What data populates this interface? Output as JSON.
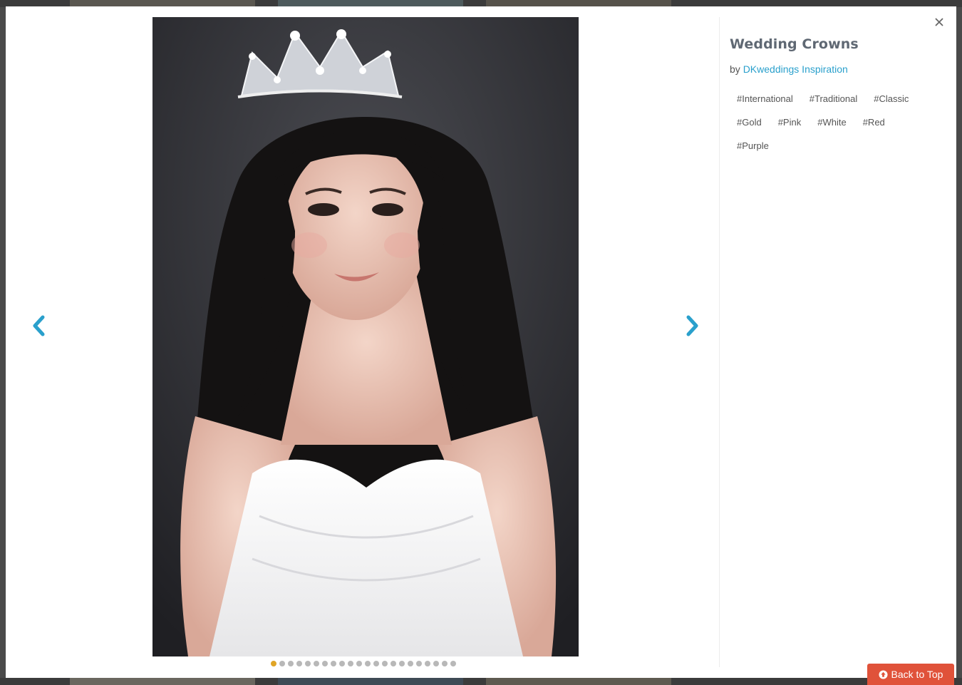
{
  "modal": {
    "title": "Wedding Crowns",
    "by_prefix": "by",
    "author": "DKweddings Inspiration",
    "tags": [
      "#International",
      "#Traditional",
      "#Classic",
      "#Gold",
      "#Pink",
      "#White",
      "#Red",
      "#Purple"
    ],
    "close_icon": "close-icon",
    "prev_icon": "chevron-left-icon",
    "next_icon": "chevron-right-icon",
    "photo_alt": "Bride wearing a silver crown",
    "slide_count": 22,
    "active_slide": 1
  },
  "back_to_top": {
    "label": "Back to Top",
    "icon": "arrow-circle-up-icon"
  },
  "colors": {
    "accent": "#2aa0cc",
    "active_dot": "#e0a526",
    "back_to_top_bg": "#e0523a",
    "title": "#5f6873"
  }
}
